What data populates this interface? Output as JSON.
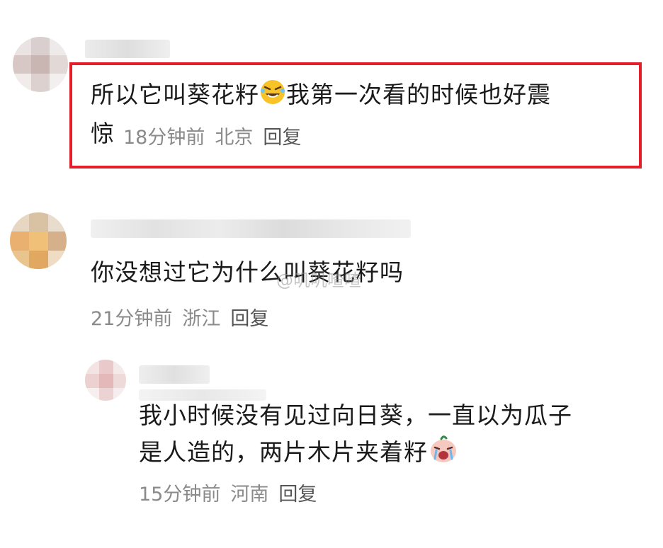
{
  "comments": [
    {
      "text_before_emoji": "所以它叫葵花籽",
      "text_after_emoji": "我第一次看的时候也好震",
      "text_line2": "惊",
      "emoji": "rofl-emoji",
      "time": "18分钟前",
      "location": "北京",
      "reply_label": "回复"
    },
    {
      "text": "你没想过它为什么叫葵花籽吗",
      "time": "21分钟前",
      "location": "浙江",
      "reply_label": "回复"
    },
    {
      "text_line1": "我小时候没有见过向日葵，一直以为瓜子",
      "text_line2": "是人造的，两片木片夹着籽",
      "emoji": "crying-emoji",
      "time": "15分钟前",
      "location": "河南",
      "reply_label": "回复"
    }
  ],
  "watermark": "@叽叽喳喳",
  "colors": {
    "highlight_border": "#e41e2b",
    "meta_text": "#8a8a8a",
    "reply_text": "#555555"
  }
}
